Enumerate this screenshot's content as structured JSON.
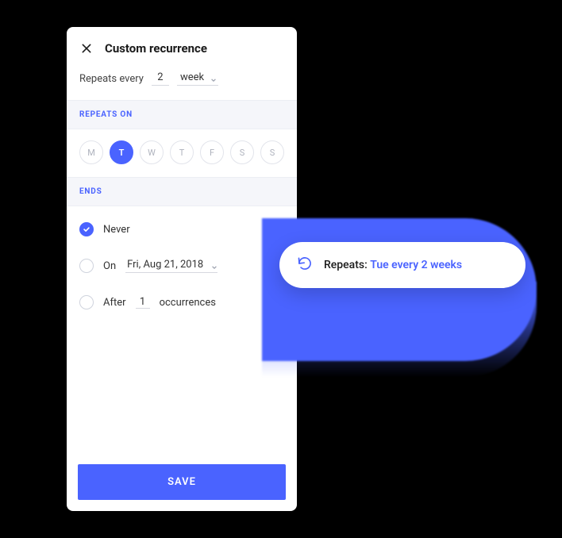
{
  "colors": {
    "accent": "#4a63ff"
  },
  "header": {
    "title": "Custom recurrence"
  },
  "repeats": {
    "label": "Repeats every",
    "interval": "2",
    "unit": "week"
  },
  "repeatsOn": {
    "heading": "REPEATS ON",
    "days": [
      "M",
      "T",
      "W",
      "T",
      "F",
      "S",
      "S"
    ],
    "selectedIndex": 1
  },
  "ends": {
    "heading": "ENDS",
    "never": {
      "label": "Never",
      "checked": true
    },
    "on": {
      "label": "On",
      "date": "Fri, Aug 21, 2018",
      "checked": false
    },
    "after": {
      "label": "After",
      "count": "1",
      "unitLabel": "occurrences",
      "checked": false
    }
  },
  "saveLabel": "SAVE",
  "summary": {
    "prefix": "Repeats: ",
    "value": "Tue every 2 weeks"
  }
}
